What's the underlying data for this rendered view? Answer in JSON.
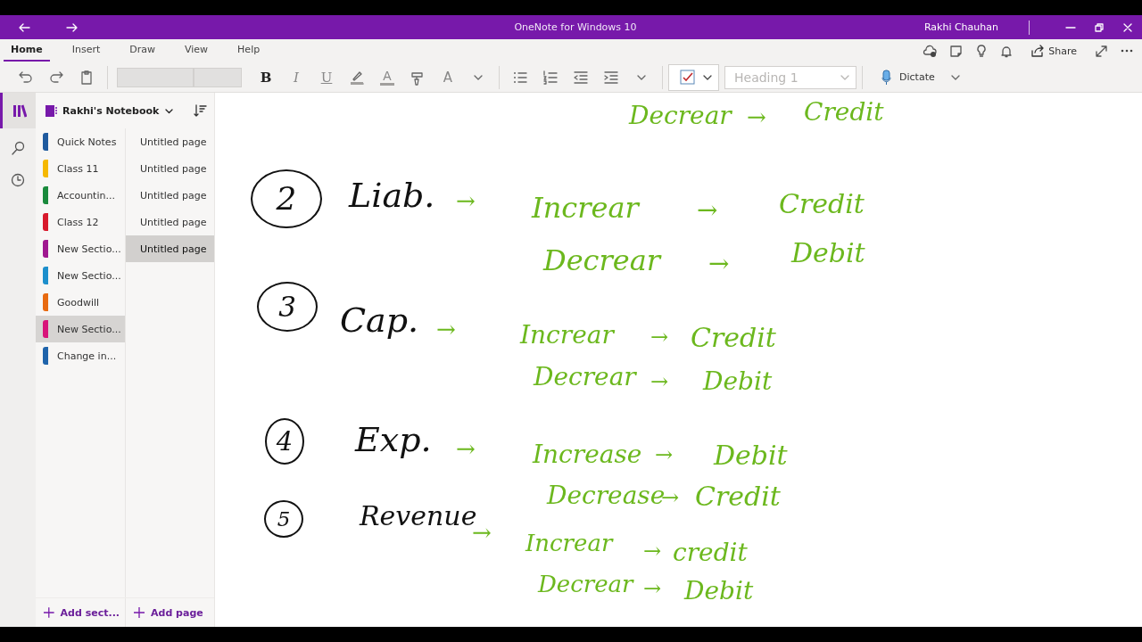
{
  "window": {
    "title": "OneNote for Windows 10",
    "user": "Rakhi Chauhan"
  },
  "ribbon": {
    "tabs": [
      {
        "label": "Home",
        "selected": true
      },
      {
        "label": "Insert",
        "selected": false
      },
      {
        "label": "Draw",
        "selected": false
      },
      {
        "label": "View",
        "selected": false
      },
      {
        "label": "Help",
        "selected": false
      }
    ],
    "share": "Share",
    "format_buttons": [
      {
        "kind": "bold",
        "label": "B"
      },
      {
        "kind": "italic",
        "label": "I"
      },
      {
        "kind": "underline",
        "label": "U"
      }
    ],
    "font_color": "A",
    "clear_formatting": "A",
    "style_box": {
      "value": "Heading 1",
      "disabled": true
    },
    "dictate": "Dictate"
  },
  "notebook": {
    "name": "Rakhi's Notebook",
    "sections": [
      {
        "label": "Quick Notes",
        "color": "#1f5a9e",
        "selected": false
      },
      {
        "label": "Class 11",
        "color": "#f5b800",
        "selected": false
      },
      {
        "label": "Accountin...",
        "color": "#1a8a3c",
        "selected": false
      },
      {
        "label": "Class 12",
        "color": "#d8192c",
        "selected": false
      },
      {
        "label": "New Sectio...",
        "color": "#a01890",
        "selected": false
      },
      {
        "label": "New Sectio...",
        "color": "#1d8fcc",
        "selected": false
      },
      {
        "label": "Goodwill",
        "color": "#e86a10",
        "selected": false
      },
      {
        "label": "New Sectio...",
        "color": "#d8147a",
        "selected": true
      },
      {
        "label": "Change in...",
        "color": "#1f64ab",
        "selected": false
      }
    ],
    "pages": [
      {
        "label": "Untitled page",
        "selected": false
      },
      {
        "label": "Untitled page",
        "selected": false
      },
      {
        "label": "Untitled page",
        "selected": false
      },
      {
        "label": "Untitled page",
        "selected": false
      },
      {
        "label": "Untitled page",
        "selected": true
      }
    ],
    "add_section": "Add sect...",
    "add_page": "Add page"
  },
  "ink": [
    {
      "kind": "word",
      "text": "Decrear",
      "color": "#6cb81e"
    },
    {
      "kind": "arrow",
      "text": "→",
      "color": "#6cb81e"
    },
    {
      "kind": "word",
      "text": "Credit",
      "color": "#6cb81e"
    },
    {
      "kind": "number",
      "text": "2",
      "color": "#111111"
    },
    {
      "kind": "word",
      "text": "Liab.",
      "color": "#111111"
    },
    {
      "kind": "arrow",
      "text": "→",
      "color": "#6cb81e"
    },
    {
      "kind": "word",
      "text": "Increar",
      "color": "#6cb81e"
    },
    {
      "kind": "arrow",
      "text": "→",
      "color": "#6cb81e"
    },
    {
      "kind": "word",
      "text": "Credit",
      "color": "#6cb81e"
    },
    {
      "kind": "word",
      "text": "Decrear",
      "color": "#6cb81e"
    },
    {
      "kind": "arrow",
      "text": "→",
      "color": "#6cb81e"
    },
    {
      "kind": "word",
      "text": "Debit",
      "color": "#6cb81e"
    },
    {
      "kind": "number",
      "text": "3",
      "color": "#111111"
    },
    {
      "kind": "word",
      "text": "Cap.",
      "color": "#111111"
    },
    {
      "kind": "arrow",
      "text": "→",
      "color": "#6cb81e"
    },
    {
      "kind": "word",
      "text": "Increar",
      "color": "#6cb81e"
    },
    {
      "kind": "arrow",
      "text": "→",
      "color": "#6cb81e"
    },
    {
      "kind": "word",
      "text": "Credit",
      "color": "#6cb81e"
    },
    {
      "kind": "word",
      "text": "Decrear",
      "color": "#6cb81e"
    },
    {
      "kind": "arrow",
      "text": "→",
      "color": "#6cb81e"
    },
    {
      "kind": "word",
      "text": "Debit",
      "color": "#6cb81e"
    },
    {
      "kind": "number",
      "text": "4",
      "color": "#111111"
    },
    {
      "kind": "word",
      "text": "Exp.",
      "color": "#111111"
    },
    {
      "kind": "arrow",
      "text": "→",
      "color": "#6cb81e"
    },
    {
      "kind": "word",
      "text": "Increase",
      "color": "#6cb81e"
    },
    {
      "kind": "arrow",
      "text": "→",
      "color": "#6cb81e"
    },
    {
      "kind": "word",
      "text": "Debit",
      "color": "#6cb81e"
    },
    {
      "kind": "word",
      "text": "Decrease",
      "color": "#6cb81e"
    },
    {
      "kind": "arrow",
      "text": "→",
      "color": "#6cb81e"
    },
    {
      "kind": "word",
      "text": "Credit",
      "color": "#6cb81e"
    },
    {
      "kind": "number",
      "text": "5",
      "color": "#111111"
    },
    {
      "kind": "word",
      "text": "Revenue",
      "color": "#111111"
    },
    {
      "kind": "arrow",
      "text": "→",
      "color": "#6cb81e"
    },
    {
      "kind": "word",
      "text": "Increar",
      "color": "#6cb81e"
    },
    {
      "kind": "arrow",
      "text": "→",
      "color": "#6cb81e"
    },
    {
      "kind": "word",
      "text": "credit",
      "color": "#6cb81e"
    },
    {
      "kind": "word",
      "text": "Decrear",
      "color": "#6cb81e"
    },
    {
      "kind": "arrow",
      "text": "→",
      "color": "#6cb81e"
    },
    {
      "kind": "word",
      "text": "Debit",
      "color": "#6cb81e"
    }
  ]
}
